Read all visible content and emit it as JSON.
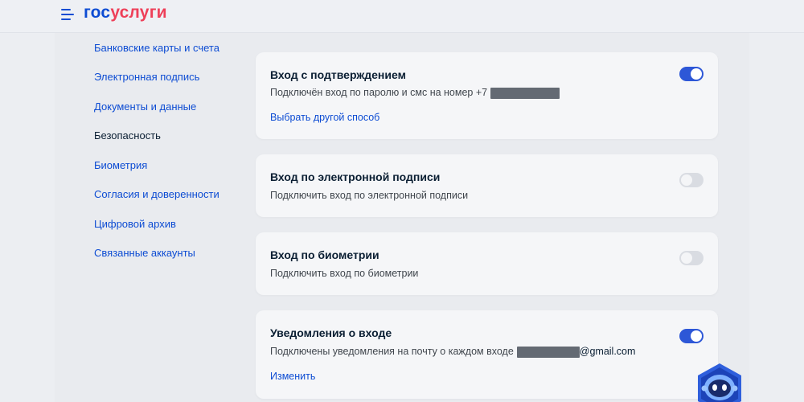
{
  "header": {
    "logo_part1": "гос",
    "logo_part2": "услуги",
    "brand_color": "#0d4cd3",
    "accent_color": "#ee3f58"
  },
  "sidebar": {
    "items": [
      {
        "label": "Банковские карты и счета",
        "active": false
      },
      {
        "label": "Электронная подпись",
        "active": false
      },
      {
        "label": "Документы и данные",
        "active": false
      },
      {
        "label": "Безопасность",
        "active": true
      },
      {
        "label": "Биометрия",
        "active": false
      },
      {
        "label": "Согласия и доверенности",
        "active": false
      },
      {
        "label": "Цифровой архив",
        "active": false
      },
      {
        "label": "Связанные аккаунты",
        "active": false
      }
    ]
  },
  "cards": {
    "confirm": {
      "title": "Вход с подтверждением",
      "desc_prefix": "Подключён вход по паролю и смс на номер +7",
      "link": "Выбрать другой способ",
      "enabled": true
    },
    "esign": {
      "title": "Вход по электронной подписи",
      "desc": "Подключить вход по электронной подписи",
      "enabled": false
    },
    "biometry": {
      "title": "Вход по биометрии",
      "desc": "Подключить вход по биометрии",
      "enabled": false
    },
    "notify": {
      "title": "Уведомления о входе",
      "desc_prefix": "Подключены уведомления на почту о каждом входе",
      "email_domain": "@gmail.com",
      "link": "Изменить",
      "enabled": true
    }
  },
  "icons": {
    "menu": "menu-icon",
    "assistant": "robot-assistant-icon"
  },
  "colors": {
    "toggle_on": "#2d57d7",
    "toggle_off": "#d9dce2",
    "link": "#0d4cd3",
    "text": "#0b1f33"
  }
}
